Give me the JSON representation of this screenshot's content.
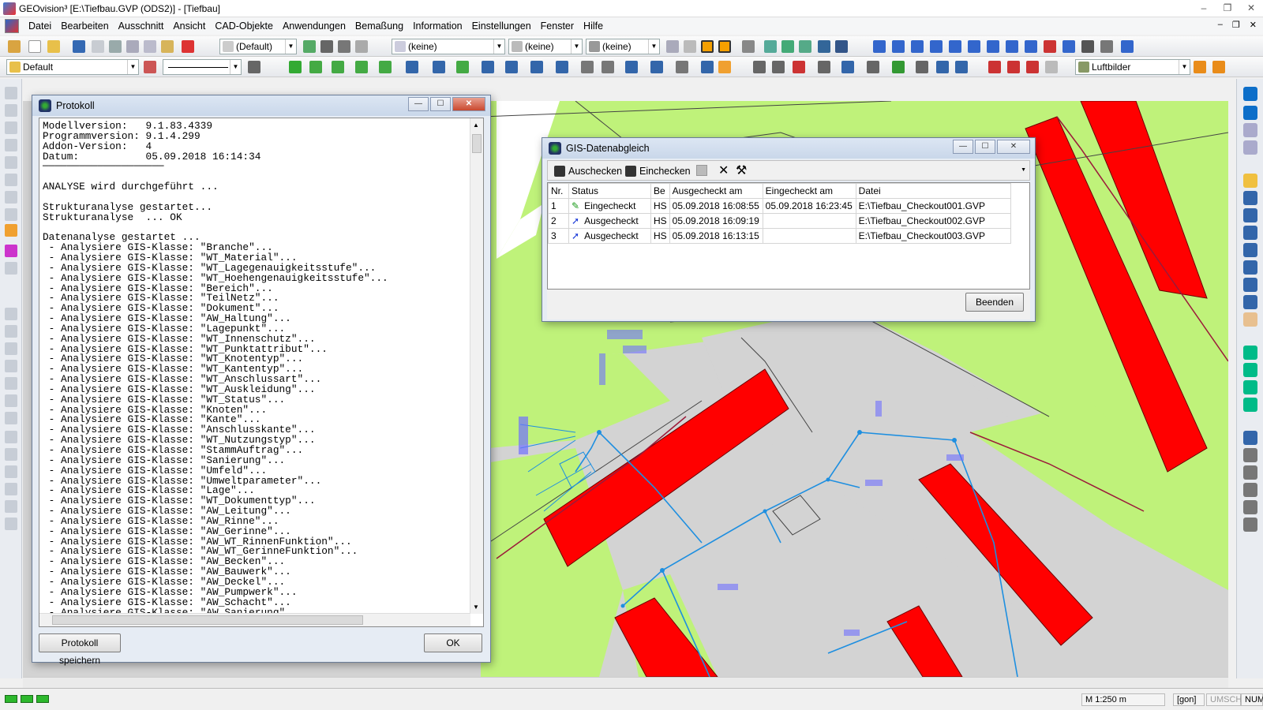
{
  "window": {
    "title": "GEOvision³  [E:\\Tiefbau.GVP (ODS2)] - [Tiefbau]",
    "controls": [
      "–",
      "❐",
      "✕"
    ]
  },
  "menu": {
    "items": [
      "Datei",
      "Bearbeiten",
      "Ausschnitt",
      "Ansicht",
      "CAD-Objekte",
      "Anwendungen",
      "Bemaßung",
      "Information",
      "Einstellungen",
      "Fenster",
      "Hilfe"
    ],
    "mdi_controls": [
      "–",
      "❐",
      "✕"
    ]
  },
  "toolbar1": {
    "combo_default": "(Default)",
    "combo_keine1": "(keine)",
    "combo_keine2": "(keine)",
    "combo_keine3": "(keine)"
  },
  "toolbar2": {
    "layer_combo": "Default",
    "luftbilder_combo": "Luftbilder"
  },
  "protokoll": {
    "title": "Protokoll",
    "lines": [
      "Modellversion:   9.1.83.4339",
      "Programmversion: 9.1.4.299",
      "Addon-Version:   4",
      "Datum:           05.09.2018 16:14:34",
      "────────────────────",
      "",
      "ANALYSE wird durchgeführt ...",
      "",
      "Strukturanalyse gestartet...",
      "Strukturanalyse  ... OK",
      "",
      "Datenanalyse gestartet ...",
      " - Analysiere GIS-Klasse: \"Branche\"...",
      " - Analysiere GIS-Klasse: \"WT_Material\"...",
      " - Analysiere GIS-Klasse: \"WT_Lagegenauigkeitsstufe\"...",
      " - Analysiere GIS-Klasse: \"WT_Hoehengenauigkeitsstufe\"...",
      " - Analysiere GIS-Klasse: \"Bereich\"...",
      " - Analysiere GIS-Klasse: \"TeilNetz\"...",
      " - Analysiere GIS-Klasse: \"Dokument\"...",
      " - Analysiere GIS-Klasse: \"AW_Haltung\"...",
      " - Analysiere GIS-Klasse: \"Lagepunkt\"...",
      " - Analysiere GIS-Klasse: \"WT_Innenschutz\"...",
      " - Analysiere GIS-Klasse: \"WT_Punktattribut\"...",
      " - Analysiere GIS-Klasse: \"WT_Knotentyp\"...",
      " - Analysiere GIS-Klasse: \"WT_Kantentyp\"...",
      " - Analysiere GIS-Klasse: \"WT_Anschlussart\"...",
      " - Analysiere GIS-Klasse: \"WT_Auskleidung\"...",
      " - Analysiere GIS-Klasse: \"WT_Status\"...",
      " - Analysiere GIS-Klasse: \"Knoten\"...",
      " - Analysiere GIS-Klasse: \"Kante\"...",
      " - Analysiere GIS-Klasse: \"Anschlusskante\"...",
      " - Analysiere GIS-Klasse: \"WT_Nutzungstyp\"...",
      " - Analysiere GIS-Klasse: \"StammAuftrag\"...",
      " - Analysiere GIS-Klasse: \"Sanierung\"...",
      " - Analysiere GIS-Klasse: \"Umfeld\"...",
      " - Analysiere GIS-Klasse: \"Umweltparameter\"...",
      " - Analysiere GIS-Klasse: \"Lage\"...",
      " - Analysiere GIS-Klasse: \"WT_Dokumenttyp\"...",
      " - Analysiere GIS-Klasse: \"AW_Leitung\"...",
      " - Analysiere GIS-Klasse: \"AW_Rinne\"...",
      " - Analysiere GIS-Klasse: \"AW_Gerinne\"...",
      " - Analysiere GIS-Klasse: \"AW_WT_RinnenFunktion\"...",
      " - Analysiere GIS-Klasse: \"AW_WT_GerinneFunktion\"...",
      " - Analysiere GIS-Klasse: \"AW_Becken\"...",
      " - Analysiere GIS-Klasse: \"AW_Bauwerk\"...",
      " - Analysiere GIS-Klasse: \"AW_Deckel\"...",
      " - Analysiere GIS-Klasse: \"AW_Pumpwerk\"...",
      " - Analysiere GIS-Klasse: \"AW_Schacht\"...",
      " - Analysiere GIS-Klasse: \"AW_Sanierung\"..."
    ],
    "save_button": "Protokoll speichern",
    "ok_button": "OK"
  },
  "gis": {
    "title": "GIS-Datenabgleich",
    "auschecken": "Auschecken",
    "einchecken": "Einchecken",
    "columns": [
      "Nr.",
      "Status",
      "Be",
      "Ausgecheckt am",
      "Eingecheckt am",
      "Datei"
    ],
    "rows": [
      {
        "nr": "1",
        "status": "Eingecheckt",
        "be": "HS",
        "aus": "05.09.2018 16:08:55",
        "ein": "05.09.2018 16:23:45",
        "datei": "E:\\Tiefbau_Checkout001.GVP"
      },
      {
        "nr": "2",
        "status": "Ausgecheckt",
        "be": "HS",
        "aus": "05.09.2018 16:09:19",
        "ein": "",
        "datei": "E:\\Tiefbau_Checkout002.GVP"
      },
      {
        "nr": "3",
        "status": "Ausgecheckt",
        "be": "HS",
        "aus": "05.09.2018 16:13:15",
        "ein": "",
        "datei": "E:\\Tiefbau_Checkout003.GVP"
      }
    ],
    "beenden_button": "Beenden"
  },
  "status": {
    "scale": "M 1:250  m",
    "unit": "[gon]",
    "umsch": "UMSCH",
    "num": "NUM"
  },
  "colors": {
    "building": "#ff0000",
    "grass": "#bff27a",
    "road": "#d4d4d4",
    "pipe": "#1e8fe0",
    "annotation": "#7070ff"
  }
}
